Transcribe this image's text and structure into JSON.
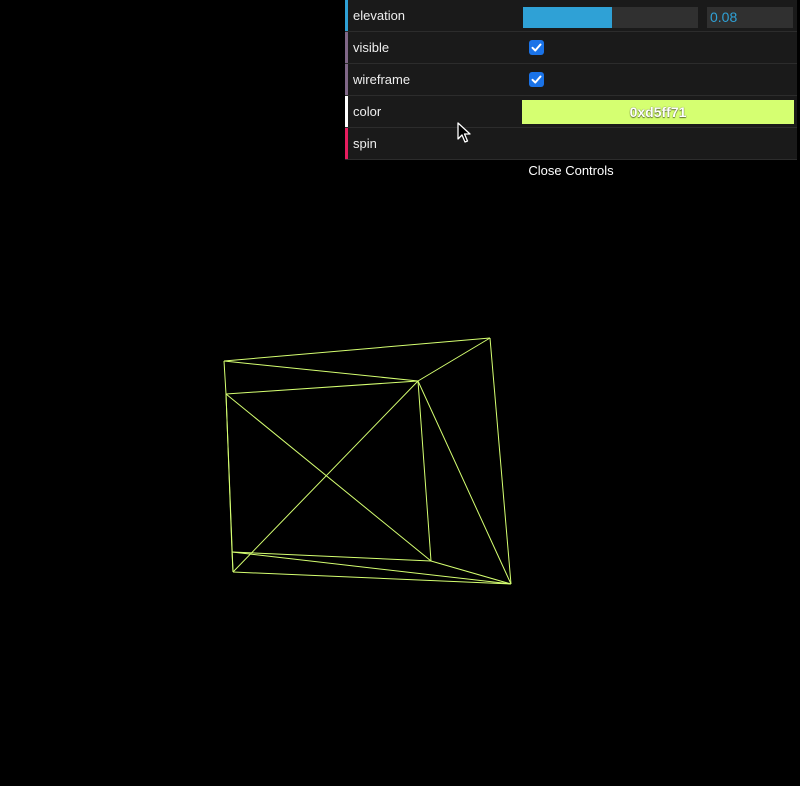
{
  "gui": {
    "elevation": {
      "label": "elevation",
      "value": "0.08",
      "fill_fraction": 0.51,
      "accent": "#2fa1d6"
    },
    "visible": {
      "label": "visible",
      "checked": true,
      "accent": "#806787"
    },
    "wireframe": {
      "label": "wireframe",
      "checked": true,
      "accent": "#806787"
    },
    "color": {
      "label": "color",
      "value": "0xd5ff71",
      "swatch": "#d5ff71",
      "accent": "#ffffff"
    },
    "spin": {
      "label": "spin",
      "accent": "#e61d5f"
    },
    "close_label": "Close Controls"
  },
  "scene": {
    "background": "#000000",
    "wire_color": "#d5ff71",
    "object": "wireframe-pyramid"
  }
}
